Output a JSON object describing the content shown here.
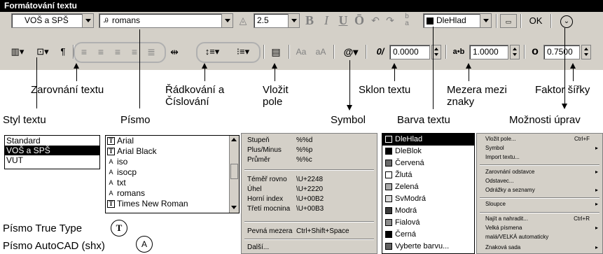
{
  "window": {
    "title": "Formátování textu"
  },
  "toolbar1": {
    "style_value": "VOŠ a SPŠ",
    "font_value": "romans",
    "height_value": "2.5",
    "bold": "B",
    "italic": "I",
    "underline": "U",
    "overline": "Ō",
    "color_value": "DleHlad",
    "ok_label": "OK"
  },
  "toolbar2": {
    "oblique_value": "0.0000",
    "tracking_value": "1.0000",
    "width_factor_value": "0.7500",
    "aa_upper": "Aa",
    "aa_lower": "aA",
    "oblique_icon_text": "0/",
    "tracking_icon_text": "a•b"
  },
  "callouts": {
    "alignment": "Zarovnání textu",
    "spacing": "Řádkování a Číslování",
    "spacing_line1": "Řádkování a",
    "spacing_line2": "Číslování",
    "insert_field": "Vložit pole",
    "insert_field_line1": "Vložit",
    "insert_field_line2": "pole",
    "oblique": "Sklon textu",
    "tracking": "Mezera mezi znaky",
    "tracking_line1": "Mezera mezi",
    "tracking_line2": "znaky",
    "width_factor": "Faktor šířky",
    "text_style": "Styl textu",
    "font": "Písmo",
    "symbol": "Symbol",
    "text_color": "Barva textu",
    "options": "Možnosti úprav"
  },
  "style_list": [
    "Standard",
    "VOŠ a SPŠ",
    "VUT"
  ],
  "font_list": [
    {
      "name": "Arial",
      "icon": "truetype-icon"
    },
    {
      "name": "Arial Black",
      "icon": "truetype-icon"
    },
    {
      "name": "iso",
      "icon": "autocad-font-icon"
    },
    {
      "name": "isocp",
      "icon": "autocad-font-icon"
    },
    {
      "name": "txt",
      "icon": "autocad-font-icon"
    },
    {
      "name": "romans",
      "icon": "autocad-font-icon"
    },
    {
      "name": "Times New Roman",
      "icon": "truetype-icon"
    }
  ],
  "legend": {
    "truetype": "Písmo True Type",
    "autocad": "Písmo AutoCAD (shx)",
    "tt_glyph": "T",
    "ac_glyph": "A"
  },
  "symbol_menu": {
    "items": [
      {
        "label": "Stupeň",
        "code": "%%d"
      },
      {
        "label": "Plus/Minus",
        "code": "%%p"
      },
      {
        "label": "Průměr",
        "code": "%%c"
      },
      {
        "label": "Téměř rovno",
        "code": "\\U+2248"
      },
      {
        "label": "Úhel",
        "code": "\\U+2220"
      },
      {
        "label": "Horní index",
        "code": "\\U+00B2"
      },
      {
        "label": "Třetí mocnina",
        "code": "\\U+00B3"
      },
      {
        "label": "Pevná mezera",
        "code": "Ctrl+Shift+Space"
      },
      {
        "label": "Další...",
        "code": ""
      }
    ]
  },
  "color_list": [
    {
      "name": "DleHlad",
      "color": "#000000"
    },
    {
      "name": "DleBlok",
      "color": "#000000"
    },
    {
      "name": "Červená",
      "color": "#6a6a6a"
    },
    {
      "name": "Žlutá",
      "color": "#ffffff"
    },
    {
      "name": "Zelená",
      "color": "#a8a8a8"
    },
    {
      "name": "SvModrá",
      "color": "#d8d8d8"
    },
    {
      "name": "Modrá",
      "color": "#3a3a3a"
    },
    {
      "name": "Fialová",
      "color": "#8a8a8a"
    },
    {
      "name": "Černá",
      "color": "#000000"
    },
    {
      "name": "Vyberte barvu...",
      "color": "#606060"
    }
  ],
  "options_menu": {
    "items": [
      {
        "label": "Vložit pole...",
        "shortcut": "Ctrl+F",
        "sub": ""
      },
      {
        "label": "Symbol",
        "shortcut": "",
        "sub": "▸"
      },
      {
        "label": "Import textu...",
        "shortcut": "",
        "sub": ""
      },
      {
        "label": "Zarovnání odstavce",
        "shortcut": "",
        "sub": "▸"
      },
      {
        "label": "Odstavec...",
        "shortcut": "",
        "sub": ""
      },
      {
        "label": "Odrážky a seznamy",
        "shortcut": "",
        "sub": "▸"
      },
      {
        "label": "Sloupce",
        "shortcut": "",
        "sub": "▸"
      },
      {
        "label": "Najít a nahradit...",
        "shortcut": "Ctrl+R",
        "sub": ""
      },
      {
        "label": "Velká písmena",
        "shortcut": "",
        "sub": "▸"
      },
      {
        "label": "malá/VELKÁ automaticky",
        "shortcut": "",
        "sub": ""
      },
      {
        "label": "Znaková sada",
        "shortcut": "",
        "sub": "▸"
      }
    ]
  }
}
